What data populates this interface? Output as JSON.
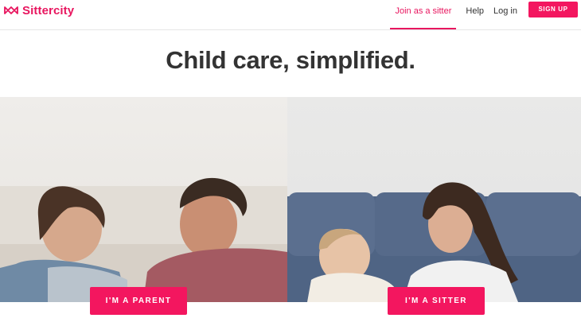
{
  "brand": {
    "name": "Sittercity",
    "color": "#e8165f"
  },
  "nav": {
    "join_label": "Join as a sitter",
    "help_label": "Help",
    "login_label": "Log in",
    "signup_label": "SIGN UP"
  },
  "hero": {
    "title": "Child care, simplified."
  },
  "cards": {
    "parent_label": "I'M A PARENT",
    "sitter_label": "I'M A SITTER"
  },
  "colors": {
    "accent": "#f3165f",
    "text": "#333333"
  }
}
